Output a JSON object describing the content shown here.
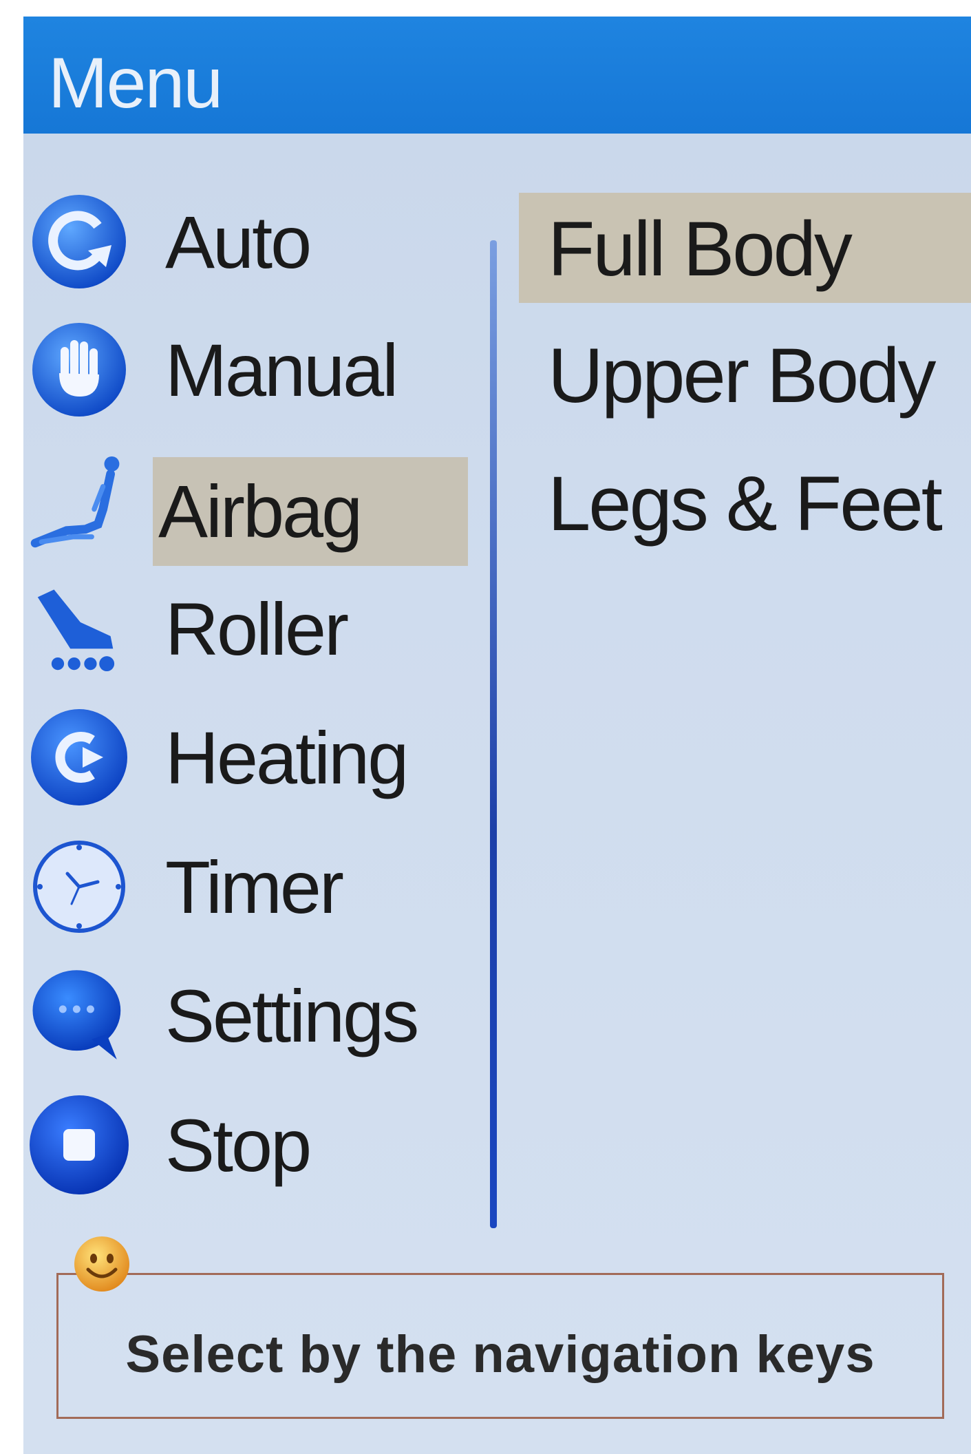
{
  "header": {
    "title": "Menu"
  },
  "menu": {
    "selected_index": 2,
    "items": [
      {
        "label": "Auto",
        "icon": "auto-cycle-icon"
      },
      {
        "label": "Manual",
        "icon": "hand-icon"
      },
      {
        "label": "Airbag",
        "icon": "reclined-person-icon"
      },
      {
        "label": "Roller",
        "icon": "roller-foot-icon"
      },
      {
        "label": "Heating",
        "icon": "heating-icon"
      },
      {
        "label": "Timer",
        "icon": "clock-icon"
      },
      {
        "label": "Settings",
        "icon": "chat-bubble-icon"
      },
      {
        "label": "Stop",
        "icon": "stop-icon"
      }
    ]
  },
  "submenu": {
    "selected_index": 0,
    "items": [
      {
        "label": "Full Body"
      },
      {
        "label": "Upper Body"
      },
      {
        "label": "Legs & Feet"
      }
    ]
  },
  "hint": {
    "text": "Select by the navigation keys",
    "icon": "smiley-icon"
  },
  "colors": {
    "titlebar": "#1677d6",
    "background": "#cfdcee",
    "selection": "#c7c2b5",
    "icon_blue": "#1b5fd8",
    "hint_border": "#a26b58"
  }
}
